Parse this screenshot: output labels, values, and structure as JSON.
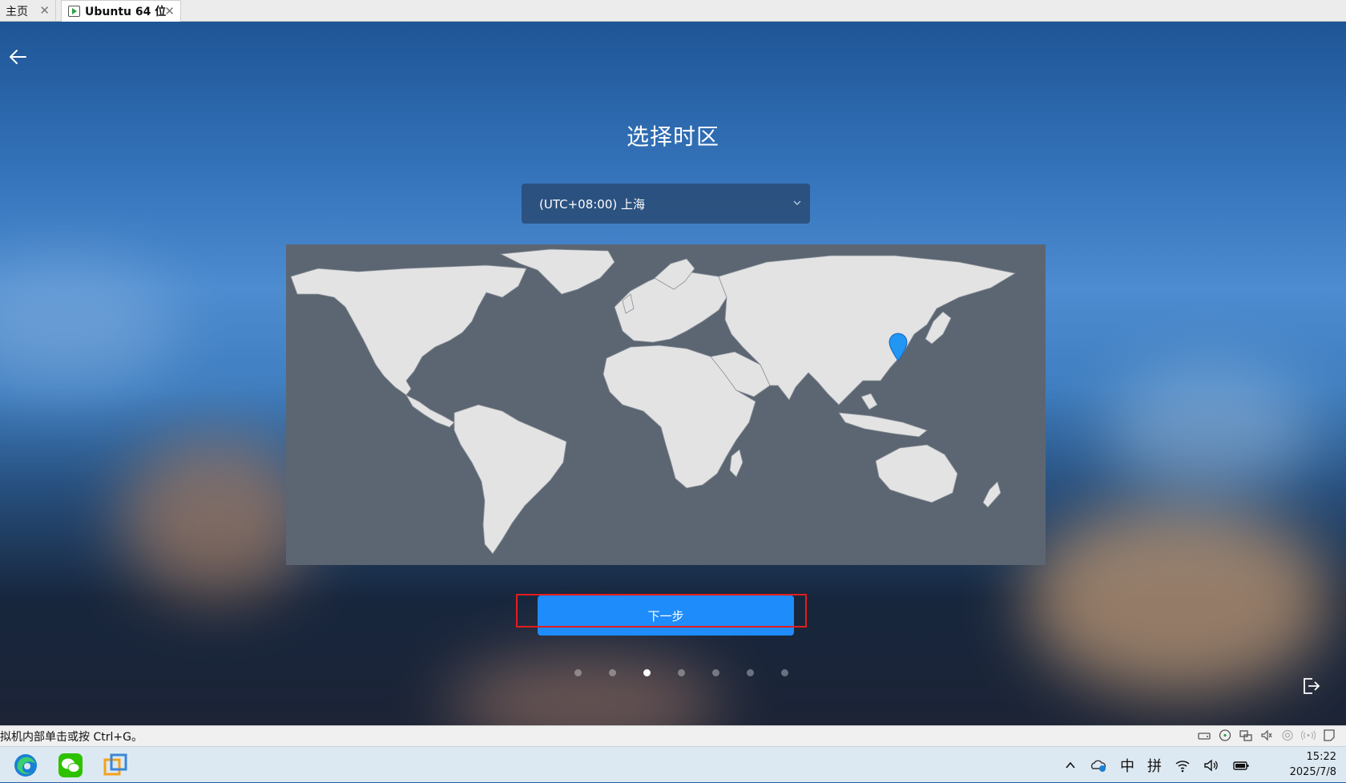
{
  "tabs": [
    {
      "label": "主页"
    },
    {
      "label": "Ubuntu 64 位"
    }
  ],
  "installer": {
    "title": "选择时区",
    "timezone_value": "(UTC+08:00) 上海",
    "next_label": "下一步",
    "step_total": 7,
    "step_current": 3
  },
  "statusbar": {
    "message": "拟机内部单击或按 Ctrl+G。"
  },
  "taskbar": {
    "apps": [
      "edge-icon",
      "wechat-icon",
      "vmware-icon"
    ],
    "ime_lang": "中",
    "ime_mode": "拼",
    "time": "15:22",
    "date": "2025/7/8"
  },
  "colors": {
    "accent": "#1e8cfa",
    "highlight": "#e31c1c",
    "map_sea": "#5c6672",
    "map_land": "#e3e3e3",
    "pin": "#2196f3"
  }
}
